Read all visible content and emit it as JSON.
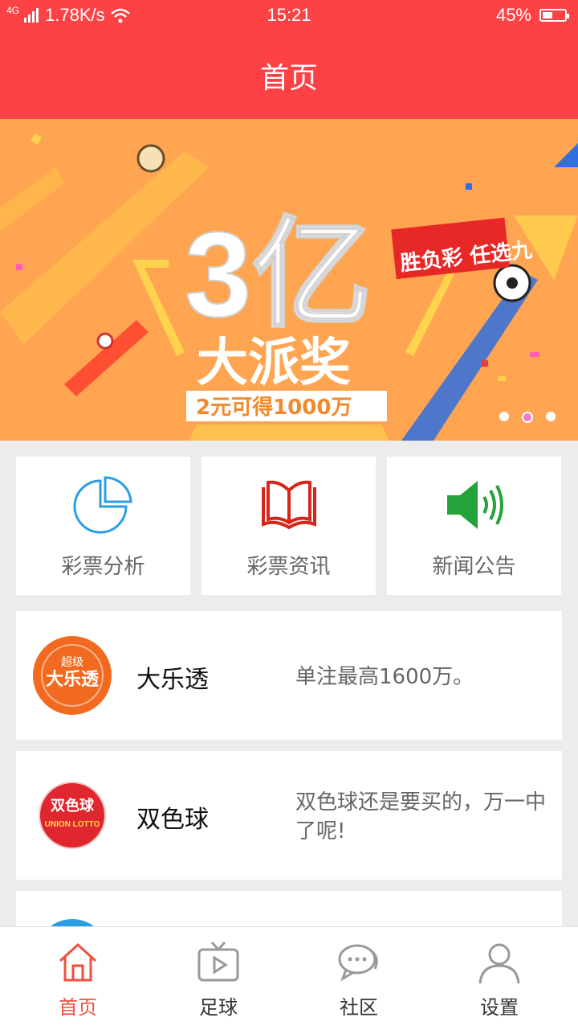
{
  "status_bar": {
    "network": "4G",
    "speed": "1.78K/s",
    "time": "15:21",
    "battery": "45%"
  },
  "header": {
    "title": "首页"
  },
  "banner": {
    "headline": "3亿",
    "subheadline": "大派奖",
    "tag": "胜负彩 任选九",
    "caption": "2元可得1000万",
    "page_count": 3,
    "active_page": 2
  },
  "quick_links": [
    {
      "label": "彩票分析",
      "icon": "pie-chart-icon"
    },
    {
      "label": "彩票资讯",
      "icon": "open-book-icon"
    },
    {
      "label": "新闻公告",
      "icon": "speaker-icon"
    }
  ],
  "lotteries": [
    {
      "name": "大乐透",
      "desc": "单注最高1600万。",
      "logo": "super-lotto-logo",
      "logo_text_top": "超级",
      "logo_text_main": "大乐透"
    },
    {
      "name": "双色球",
      "desc": "双色球还是要买的，万一中了呢!",
      "logo": "union-lotto-logo",
      "logo_text_top": "双色球",
      "logo_text_main": "UNION LOTTO"
    },
    {
      "name": "",
      "desc": "",
      "logo": "partial-logo"
    }
  ],
  "tabs": [
    {
      "label": "首页",
      "icon": "home-icon",
      "active": true
    },
    {
      "label": "足球",
      "icon": "tv-icon",
      "active": false
    },
    {
      "label": "社区",
      "icon": "chat-bubbles-icon",
      "active": false
    },
    {
      "label": "设置",
      "icon": "user-icon",
      "active": false
    }
  ],
  "colors": {
    "primary": "#fc4245",
    "banner": "#ffa552",
    "active_tab": "#f0503e",
    "green_icon": "#23a33a",
    "blue_icon": "#2a9ee4"
  }
}
